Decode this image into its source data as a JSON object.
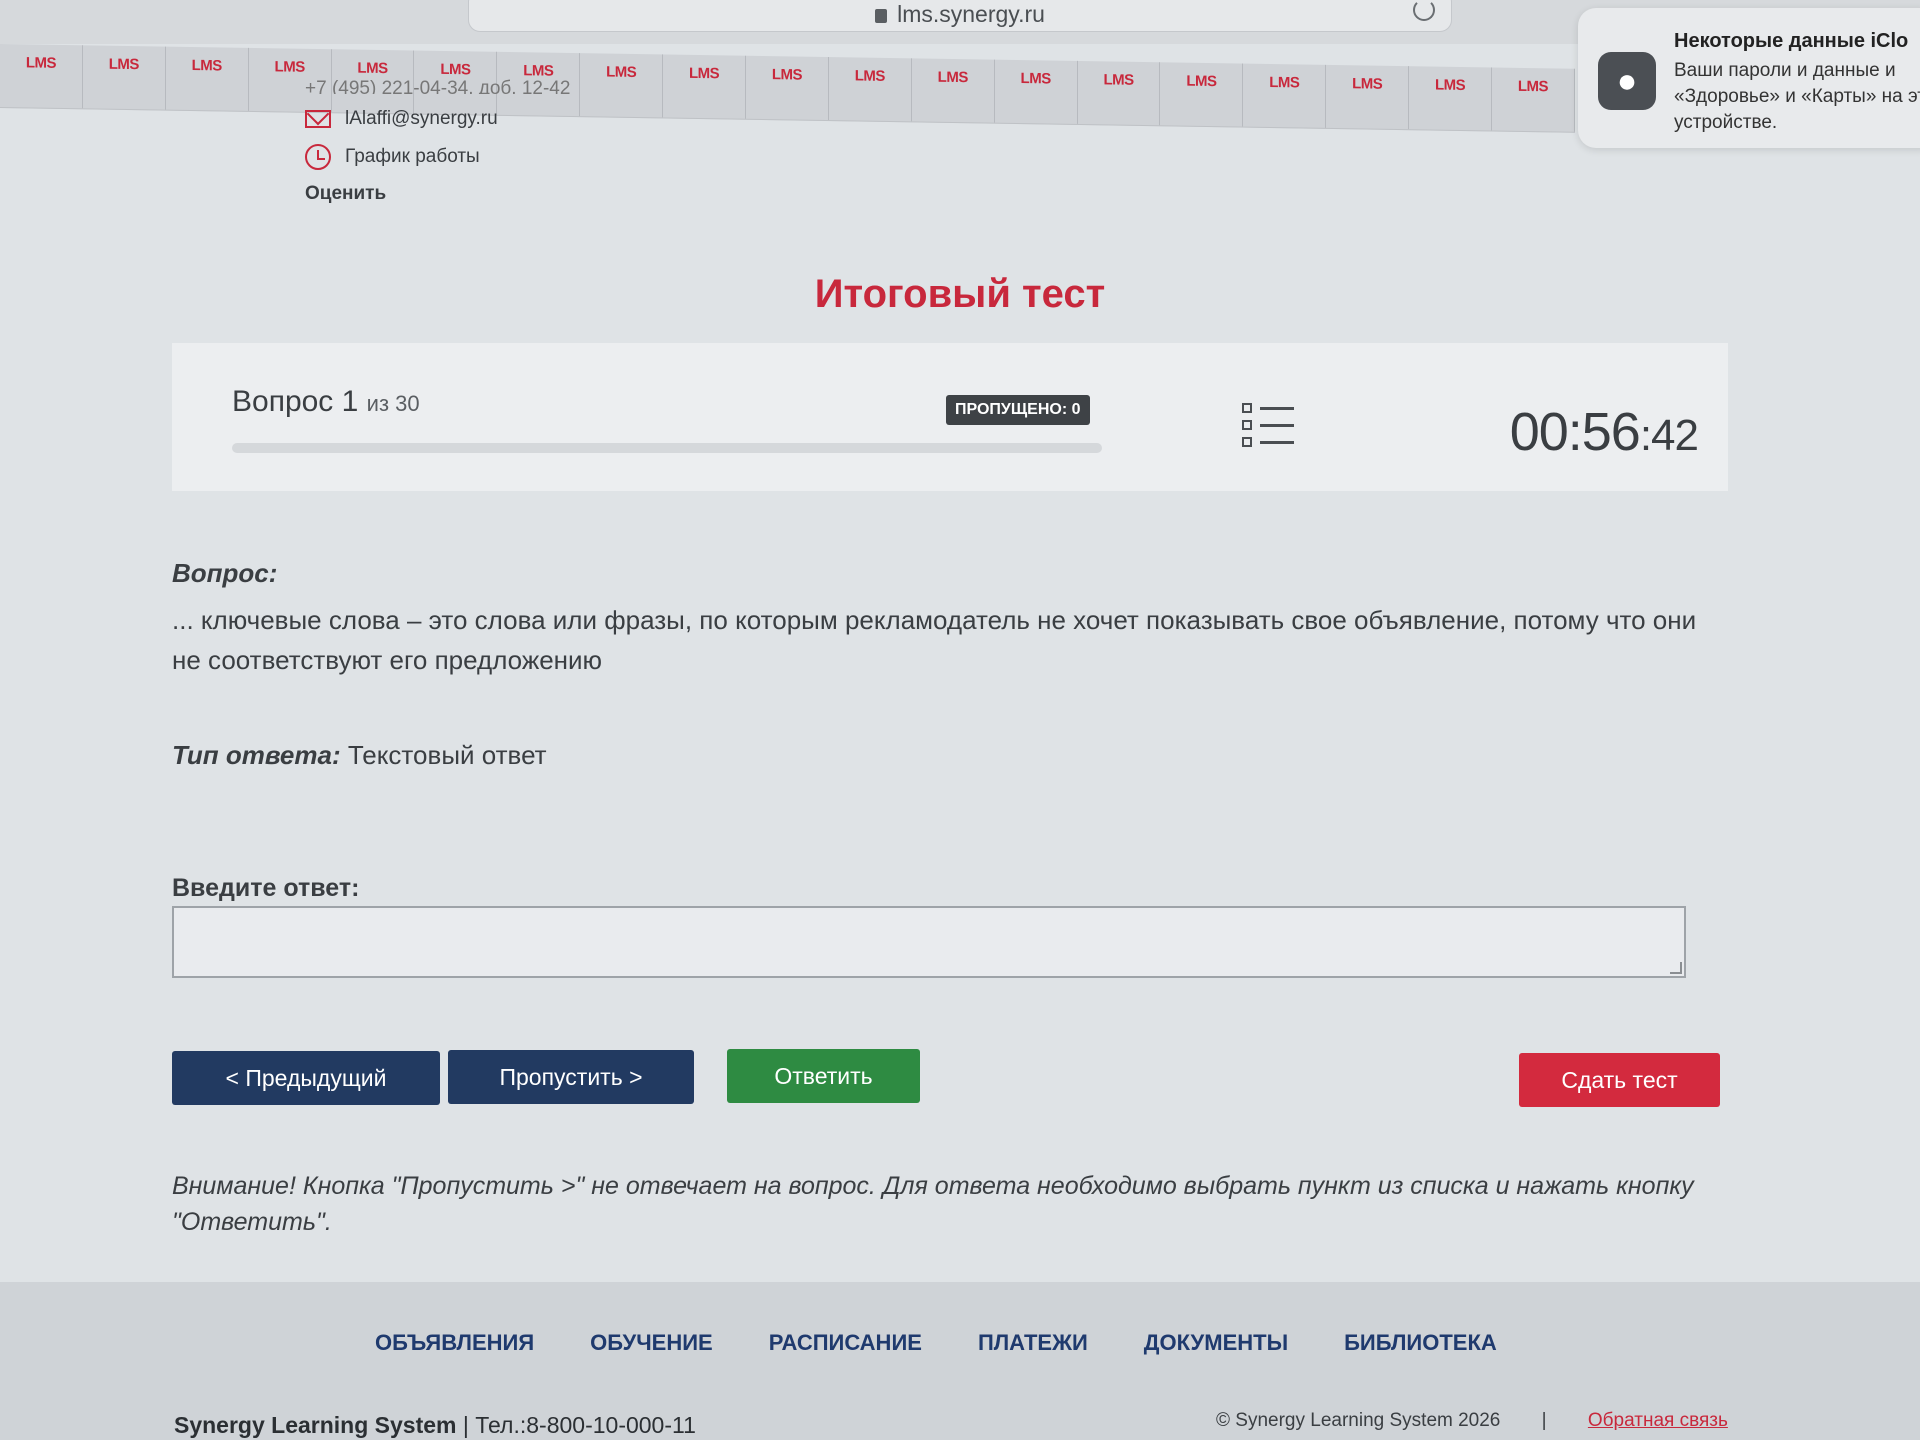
{
  "browser": {
    "url": "lms.synergy.ru"
  },
  "lms_strip": {
    "tab_label": "LMS",
    "tab_count": 19
  },
  "notification": {
    "title": "Некоторые данные iClo",
    "body": "Ваши пароли и данные и «Здоровье» и «Карты» на этом устройстве."
  },
  "contact": {
    "phone": "+7 (495) 221-04-34, доб. 12-42",
    "email": "lAlaffi@synergy.ru",
    "schedule": "График работы",
    "rate": "Оценить"
  },
  "page_title": "Итоговый тест",
  "progress": {
    "question_label": "Вопрос 1",
    "question_of": "из 30",
    "current": 1,
    "total": 30,
    "skipped": "ПРОПУЩЕНО: 0",
    "timer_main": "00:56",
    "timer_sec": ":42"
  },
  "question": {
    "heading": "Вопрос:",
    "text": "... ключевые слова – это слова или фразы, по которым рекламодатель не хочет показывать свое объявление, потому что они не соответствуют его предложению",
    "type_label": "Тип ответа:",
    "type_value": "Текстовый ответ"
  },
  "answer": {
    "label": "Введите ответ:",
    "value": ""
  },
  "buttons": {
    "prev": "< Предыдущий",
    "skip": "Пропустить >",
    "answer": "Ответить",
    "submit": "Сдать тест"
  },
  "warning": "Внимание! Кнопка \"Пропустить >\" не отвечает на вопрос. Для ответа необходимо выбрать пункт из списка и нажать кнопку \"Ответить\".",
  "footer": {
    "nav": [
      "ОБЪЯВЛЕНИЯ",
      "ОБУЧЕНИЕ",
      "РАСПИСАНИЕ",
      "ПЛАТЕЖИ",
      "ДОКУМЕНТЫ",
      "БИБЛИОТЕКА"
    ],
    "brand": "Synergy Learning System",
    "phone": "Тел.:8-800-10-000-11",
    "copyright": "© Synergy Learning System 2026",
    "feedback": "Обратная связь"
  },
  "colors": {
    "accent_red": "#c8283c",
    "navy": "#223a61",
    "green": "#2e8b42",
    "submit_red": "#d32a3e"
  }
}
